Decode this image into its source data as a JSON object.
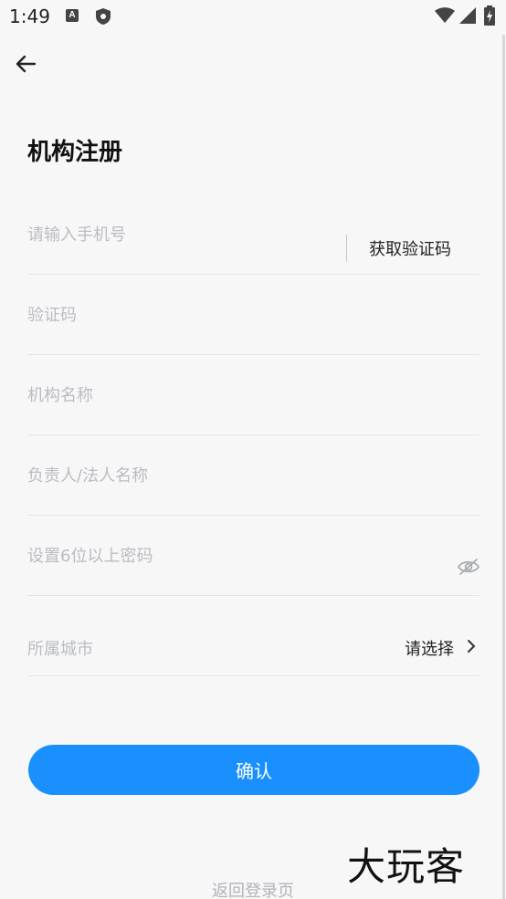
{
  "status_bar": {
    "time": "1:49",
    "icons": [
      "notification-a-icon",
      "shield-icon",
      "wifi-icon",
      "signal-icon",
      "battery-icon"
    ]
  },
  "header": {
    "back_icon": "arrow-left-icon",
    "title": "机构注册"
  },
  "form": {
    "phone": {
      "placeholder": "请输入手机号",
      "value": ""
    },
    "get_code_label": "获取验证码",
    "code": {
      "placeholder": "验证码",
      "value": ""
    },
    "org_name": {
      "placeholder": "机构名称",
      "value": ""
    },
    "legal_person": {
      "placeholder": "负责人/法人名称",
      "value": ""
    },
    "password": {
      "placeholder": "设置6位以上密码",
      "value": "",
      "toggle_icon": "eye-off-icon"
    },
    "city": {
      "label": "所属城市",
      "select_text": "请选择",
      "chevron_icon": "chevron-right-icon"
    }
  },
  "confirm_label": "确认",
  "return_link": "返回登录页",
  "watermark": "大玩客",
  "colors": {
    "accent": "#1a90ff",
    "background": "#f7f7f7",
    "placeholder": "#b9bcc3",
    "divider": "#e4e4e4"
  }
}
